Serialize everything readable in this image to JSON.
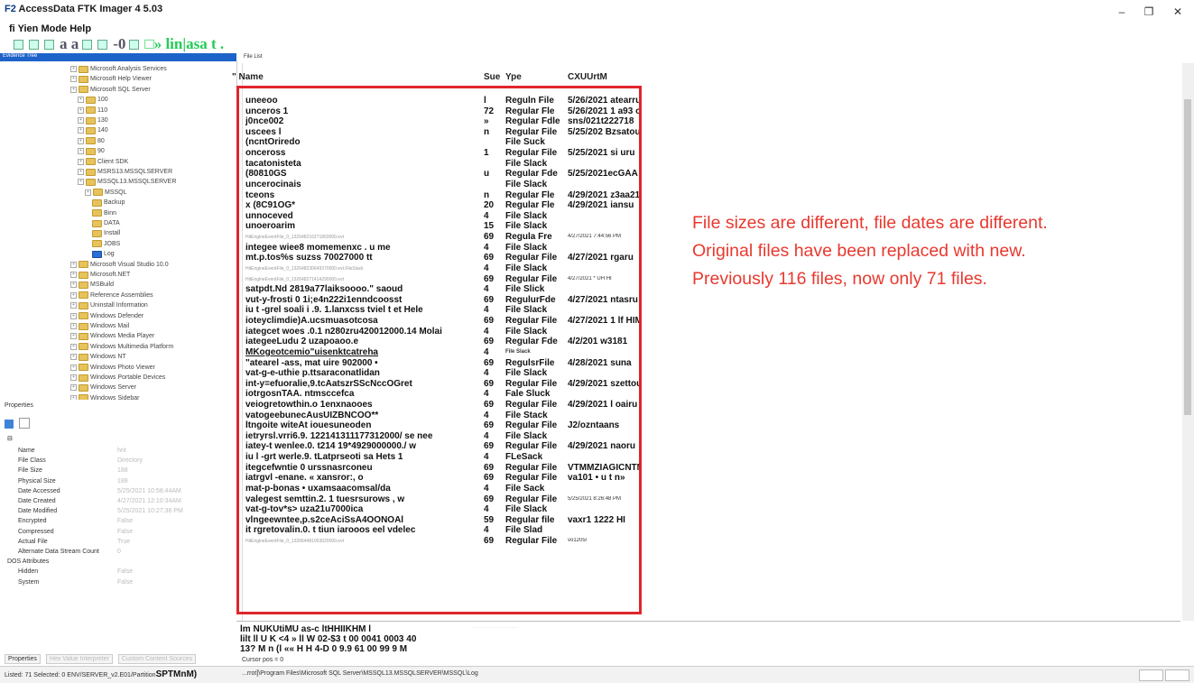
{
  "window": {
    "title_prefix": "F2",
    "title": "AccessData FTK Imager 4 5.03",
    "controls": {
      "minimize": "–",
      "maximize": "❐",
      "close": "✕"
    }
  },
  "menubar": "fi Yien Mode Help",
  "toolbar": {
    "text_a": "a a",
    "text_b": "-0",
    "text_c": "□» lin|asa t ."
  },
  "evidence_tree": {
    "header": "Evidence Tree",
    "items": [
      "Microsoft Analysis Services",
      "Microsoft Help Viewer",
      "Microsoft SQL Server",
      "100",
      "110",
      "130",
      "140",
      "80",
      "90",
      "Client SDK",
      "MSRS13.MSSQLSERVER",
      "MSSQL13.MSSQLSERVER",
      "MSSQL",
      "Backup",
      "Binn",
      "DATA",
      "Install",
      "JOBS",
      "Log",
      "Microsoft Visual Studio 10.0",
      "Microsoft.NET",
      "MSBuild",
      "Reference Assemblies",
      "Uninstall Information",
      "Windows Defender",
      "Windows Mail",
      "Windows Media Player",
      "Windows Multimedia Platform",
      "Windows NT",
      "Windows Photo Viewer",
      "Windows Portable Devices",
      "Windows Server",
      "Windows Sidebar"
    ]
  },
  "properties": {
    "label": "Properties",
    "rows": [
      {
        "key": "Name",
        "value": "hrir"
      },
      {
        "key": "File Class",
        "value": "Directory"
      },
      {
        "key": "File Size",
        "value": "188"
      },
      {
        "key": "Physical Size",
        "value": "188"
      },
      {
        "key": "Date Accessed",
        "value": "5/25/2021 10:58:44AM"
      },
      {
        "key": "Date Created",
        "value": "4/27/2021 12:10:34AM"
      },
      {
        "key": "Date Modified",
        "value": "5/25/2021 10:27:36 PM"
      },
      {
        "key": "Encrypted",
        "value": "False"
      },
      {
        "key": "Compressed",
        "value": "False"
      },
      {
        "key": "Actual File",
        "value": "True"
      },
      {
        "key": "Alternate Data Stream Count",
        "value": "0"
      },
      {
        "key": "DOS Attributes",
        "value": ""
      },
      {
        "key": "Hidden",
        "value": "False"
      },
      {
        "key": "System",
        "value": "False"
      }
    ],
    "tabs": [
      "Properties",
      "Hex Value Interpreter",
      "Custom Content Sources"
    ]
  },
  "file_list": {
    "label": "File List",
    "columns": {
      "name": "\" Name",
      "size": "Sue",
      "type": "Ype",
      "date": "CXUUrtM"
    },
    "rows": [
      {
        "name": "uneeoo",
        "size": "l",
        "type": "Reguln File",
        "date": "5/26/2021 atearru"
      },
      {
        "name": "unceros 1",
        "size": "72",
        "type": "Regular Fle",
        "date": "5/26/2021 1 a93 ou"
      },
      {
        "name": "j0nce002",
        "size": "»",
        "type": "Regular Fdle",
        "date": "sns/021t222718"
      },
      {
        "name": "uscees l",
        "size": "n",
        "type": "Regular File",
        "date": "5/25/202 Bzsatou"
      },
      {
        "name": "(ncntOriredo",
        "size": "",
        "type": "File Suck",
        "date": ""
      },
      {
        "name": "onceross",
        "size": "1",
        "type": "Regular File",
        "date": "5/25/2021 si uru"
      },
      {
        "name": "tacatonisteta",
        "size": "",
        "type": "File Slack",
        "date": ""
      },
      {
        "name": "(80810GS",
        "size": "u",
        "type": "Regular Fde",
        "date": "5/25/2021ecGAA"
      },
      {
        "name": "uncerocinais",
        "size": "",
        "type": "File Slack",
        "date": ""
      },
      {
        "name": "tceons",
        "size": "n",
        "type": "Regular Fle",
        "date": "4/29/2021 z3aa21u"
      },
      {
        "name": "x (8C91OG*",
        "size": "20",
        "type": "Regular Fle",
        "date": "4/29/2021 iansu"
      },
      {
        "name": "unnoceved",
        "size": "4",
        "type": "File Slack",
        "date": ""
      },
      {
        "name": "unoeroarim",
        "size": "15",
        "type": "File Slack",
        "date": ""
      },
      {
        "name": "HitEngineEventFile_0_132648216271803000.evt",
        "size": "69",
        "type": "Regula Fre",
        "date": "4/27/2021 7:44:56 PM",
        "small": true
      },
      {
        "name": "integee wiee8 momemenxc . u me",
        "size": "4",
        "type": "File Slack",
        "date": ""
      },
      {
        "name": "mt.p.tos%s suzss 70027000 tt",
        "size": "69",
        "type": "Regular File",
        "date": "4/27/2021 rgaru"
      },
      {
        "name": "HitEngineEventFile_0_132648230649370000.evt.FileSlack",
        "size": "4",
        "type": "File Slack",
        "date": "",
        "small": true
      },
      {
        "name": "HitEngineEventFile_0_132648271414290000.evt",
        "size": "69",
        "type": "Regular File",
        "date": "4/27/2021 * UH HI",
        "small": true
      },
      {
        "name": "satpdt.Nd  2819a77laiksoooo.\"  saoud",
        "size": "4",
        "type": "File Slick",
        "date": ""
      },
      {
        "name": "vut-y-frosti 0 1i;e4n222i1enndcoosst",
        "size": "69",
        "type": "RegulurFde",
        "date": "4/27/2021 ntasru"
      },
      {
        "name": "iu t -grel soali i .9. 1.lanxcss tviel t et Hele",
        "size": "4",
        "type": "File Slack",
        "date": ""
      },
      {
        "name": "ioteyclimdie)A.ucsmuasotcosa",
        "size": "69",
        "type": "Regular File",
        "date": "4/27/2021 1 lf HIM"
      },
      {
        "name": "iategcet woes .0.1 n280zru420012000.14 Molai",
        "size": "4",
        "type": "File Slack",
        "date": ""
      },
      {
        "name": "iategeeLudu 2 uzapoaoo.e",
        "size": "69",
        "type": "Regular Fde",
        "date": "4/2/201 w3181"
      },
      {
        "name": "MKogeotcemio\"uisenktcatreha",
        "size": "4",
        "type": "File Slack",
        "date": "",
        "type_small": true
      },
      {
        "name": "\"atearel -ass, mat uire 902000 •",
        "size": "69",
        "type": "RegulsrFile",
        "date": "4/28/2021 suna"
      },
      {
        "name": "vat-g-e-uthie p.ttsaraconatlidan",
        "size": "4",
        "type": "File Slack",
        "date": ""
      },
      {
        "name": "int-y=efuoralie,9.tcAatszrSScNccOGret",
        "size": "69",
        "type": "Regular File",
        "date": "4/29/2021 szettou"
      },
      {
        "name": "iotrgosnTAA. ntmsccefca",
        "size": "4",
        "type": "Fale Sluck",
        "date": ""
      },
      {
        "name": "veiogretowthin.o 1enxnaooes",
        "size": "69",
        "type": "Regular File",
        "date": "4/29/2021 l oairu"
      },
      {
        "name": "vatogeebunecAusUIZBNCOO**",
        "size": "4",
        "type": "File Stack",
        "date": ""
      },
      {
        "name": "ltngoite witeAt iouesuneoden",
        "size": "69",
        "type": "Regular File",
        "date": "J2/ozntaans"
      },
      {
        "name": "ietryrsl.vrri6.9. 122141311177312000/ se nee",
        "size": "4",
        "type": "File Slack",
        "date": ""
      },
      {
        "name": "iatey-t wenlee.0. t214 19*4929000000./ w",
        "size": "69",
        "type": "Regular File",
        "date": "4/29/2021 naoru"
      },
      {
        "name": "iu l -grt werle.9. tLatprseoti sa Hets 1",
        "size": "4",
        "type": "FLeSack",
        "date": ""
      },
      {
        "name": "itegcefwntie 0 urssnasrconeu",
        "size": "69",
        "type": "Regular File",
        "date": "VTMMZIAGICNTM"
      },
      {
        "name": "iatrgvl -enane. « xansror:, o",
        "size": "69",
        "type": "Regular File",
        "date": "va101 • u t n»"
      },
      {
        "name": "mat-p-bonas • uxamsaacomsal/da",
        "size": "4",
        "type": "File Sack",
        "date": ""
      },
      {
        "name": "valegest semttin.2. 1 tuesrsurows , w",
        "size": "69",
        "type": "Regular File",
        "date": "5/25/2021 8:26:48 PM",
        "date_small": true
      },
      {
        "name": "vat-g-tov*s> uza21u7000ica",
        "size": "4",
        "type": "File Slack",
        "date": ""
      },
      {
        "name": "vlngeewntee,p.s2ceAciSsA4OONOAl",
        "size": "59",
        "type": "Regular file",
        "date": "vaxr1 1222 HI"
      },
      {
        "name": "it rgretovalin.0. t tiun iarooos eel vdelec",
        "size": "4",
        "type": "File Slad",
        "date": ""
      },
      {
        "name": "HitEngineEventFile_0_132664481003020000.evt",
        "size": "69",
        "type": "Regular File",
        "date": "vo1205/",
        "small": true
      }
    ]
  },
  "annotation": "File sizes are different, file dates are different. Original files have been replaced with new. Previously 116 files, now only 71 files.",
  "hex": {
    "lines": [
      "lm NUKUtiMU as-c ltHHIIKHM l",
      "lilt ll U K <4 » ll W 02-$3 t 00 0041 0003 40",
      "13? M n (l «« H H 4-D 0 9.9 61 00 99 9 M"
    ],
    "ascii": ". . . . . . . . . . . . . . . . . .",
    "cursor": "Cursor pos = 0"
  },
  "status": {
    "left": "Listed: 71  Selected: 0  ENV/SERVER_v2.E01/Partition",
    "left_bold": "SPTMnM)",
    "path": "...rrot]\\Program Files\\Microsoft SQL Server\\MSSQL13.MSSQLSERVER\\MSSQL\\Log"
  },
  "colors": {
    "annotation": "#e8392f",
    "highlight_box": "#e0262b",
    "tree_header": "#1d63c9"
  }
}
